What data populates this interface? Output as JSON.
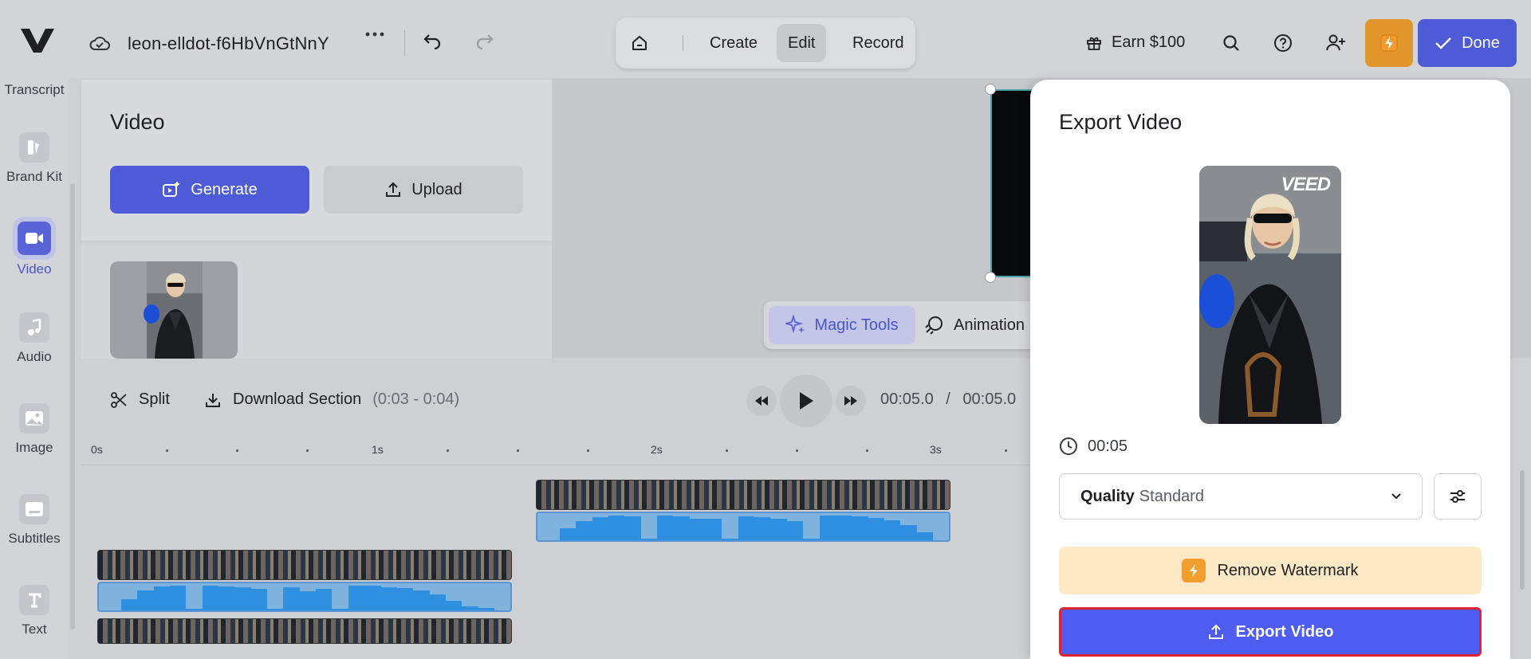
{
  "header": {
    "project_title": "leon-elldot-f6HbVnGtNnY",
    "tabs": [
      "Create",
      "Edit",
      "Record"
    ],
    "earn_label": "Earn $100",
    "done_label": "Done"
  },
  "sidebar": {
    "items": [
      {
        "label": "Transcript"
      },
      {
        "label": "Brand Kit"
      },
      {
        "label": "Video",
        "active": true
      },
      {
        "label": "Audio"
      },
      {
        "label": "Image"
      },
      {
        "label": "Subtitles"
      },
      {
        "label": "Text"
      }
    ]
  },
  "media_panel": {
    "title": "Video",
    "generate_label": "Generate",
    "upload_label": "Upload"
  },
  "canvas": {
    "magic_tools_label": "Magic Tools",
    "animation_label": "Animation"
  },
  "timeline": {
    "split_label": "Split",
    "download_label": "Download Section",
    "range": "(0:03 - 0:04)",
    "current_time": "00:05.0",
    "separator": "/",
    "total_time": "00:05.0",
    "ruler": [
      "0s",
      "1s",
      "2s",
      "3s"
    ]
  },
  "export": {
    "title": "Export Video",
    "watermark": "VEED",
    "duration": "00:05",
    "quality_label": "Quality",
    "quality_value": "Standard",
    "remove_watermark_label": "Remove Watermark",
    "export_label": "Export Video"
  },
  "colors": {
    "accent": "#4e5bd6",
    "export_button": "#4f5cf0",
    "warning": "#e0962a",
    "highlight_border": "#e0242f"
  }
}
